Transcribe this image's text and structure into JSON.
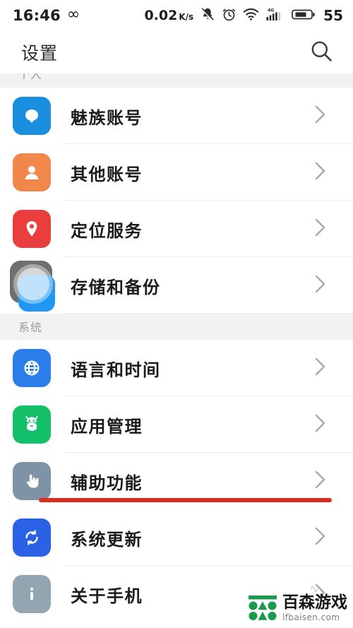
{
  "status_bar": {
    "time": "16:46",
    "infinity_glyph": "∞",
    "network_speed": "0.02",
    "network_speed_unit": "K/s",
    "icons": [
      "bell-muted-icon",
      "alarm-clock-icon",
      "wifi-icon",
      "signal-4g-icon",
      "battery-icon"
    ],
    "signal_label": "4G",
    "battery_level": "55"
  },
  "header": {
    "title": "设置",
    "search_icon": "search-icon"
  },
  "sections": [
    {
      "id": "personal",
      "label": "个人",
      "clipped": true,
      "items": [
        {
          "label": "魅族账号",
          "icon": "meizu-account-icon",
          "color": "#1a8fe0"
        },
        {
          "label": "其他账号",
          "icon": "user-account-icon",
          "color": "#f1874a"
        },
        {
          "label": "定位服务",
          "icon": "location-pin-icon",
          "color": "#ea3d3d"
        },
        {
          "label": "存储和备份",
          "icon": "storage-backup-icon",
          "color": "#6f6f6f"
        }
      ]
    },
    {
      "id": "system",
      "label": "系统",
      "clipped": false,
      "items": [
        {
          "label": "语言和时间",
          "icon": "globe-icon",
          "color": "#2b7de9"
        },
        {
          "label": "应用管理",
          "icon": "android-robot-icon",
          "color": "#15c06a"
        },
        {
          "label": "辅助功能",
          "icon": "hand-pointer-icon",
          "color": "#7e93a6",
          "annotated": true
        },
        {
          "label": "系统更新",
          "icon": "refresh-sync-icon",
          "color": "#2b62e5"
        },
        {
          "label": "关于手机",
          "icon": "info-icon",
          "color": "#94a5b2"
        }
      ]
    }
  ],
  "annotation": {
    "color": "#e02b20",
    "target": "辅助功能"
  },
  "watermark": {
    "name_cn": "百森游戏",
    "domain": "lfbaisen.com",
    "mark_color": "#1a9b4c",
    "squiggle": "∿"
  },
  "chevron_glyph": "›"
}
